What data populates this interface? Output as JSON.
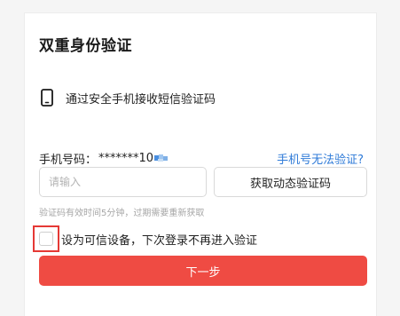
{
  "dialog": {
    "title": "双重身份验证"
  },
  "method": {
    "icon": "mobile-phone-icon",
    "text": "通过安全手机接收短信验证码"
  },
  "phone": {
    "label": "手机号码：",
    "number": "*******10",
    "cannot_verify_link": "手机号无法验证?"
  },
  "code": {
    "placeholder": "请输入",
    "value": "",
    "get_code_button": "获取动态验证码",
    "hint": "验证码有效时间5分钟，过期需要重新获取"
  },
  "trust": {
    "checked": false,
    "label": "设为可信设备，下次登录不再进入验证"
  },
  "actions": {
    "next_button": "下一步"
  },
  "colors": {
    "primary_button": "#ef4b43",
    "link": "#2f7bd8",
    "highlight_border": "#e53935"
  }
}
